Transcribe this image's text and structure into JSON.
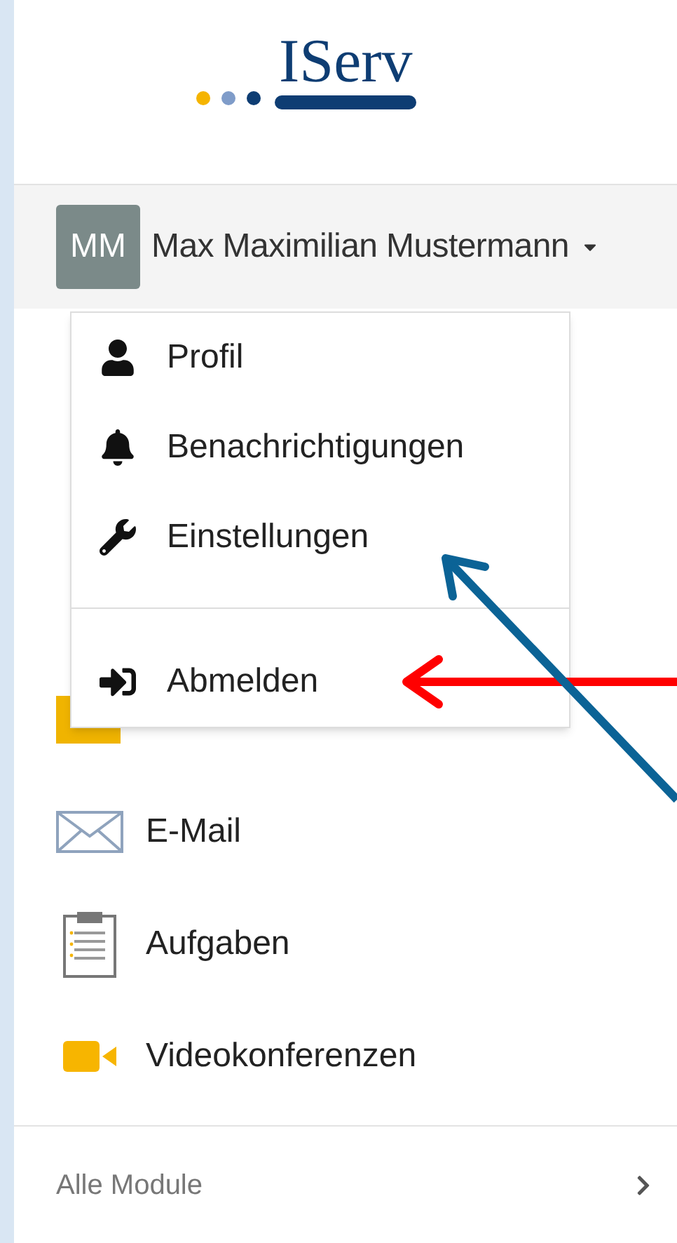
{
  "logo": {
    "text": "IServ"
  },
  "user": {
    "initials": "MM",
    "name": "Max Maximilian Mustermann"
  },
  "dropdown": {
    "groups": [
      [
        {
          "kind": "profile",
          "label": "Profil"
        },
        {
          "kind": "notifications",
          "label": "Benachrichtigungen"
        },
        {
          "kind": "settings",
          "label": "Einstellungen"
        }
      ],
      [
        {
          "kind": "logout",
          "label": "Abmelden"
        }
      ]
    ]
  },
  "sidebar": {
    "items": [
      {
        "kind": "mail",
        "label": "E-Mail"
      },
      {
        "kind": "tasks",
        "label": "Aufgaben"
      },
      {
        "kind": "video",
        "label": "Videokonferenzen"
      }
    ],
    "all_modules": "Alle Module"
  },
  "annotations": [
    {
      "kind": "arrow",
      "color": "#ff0000"
    },
    {
      "kind": "arrow",
      "color": "#0b6396"
    }
  ]
}
